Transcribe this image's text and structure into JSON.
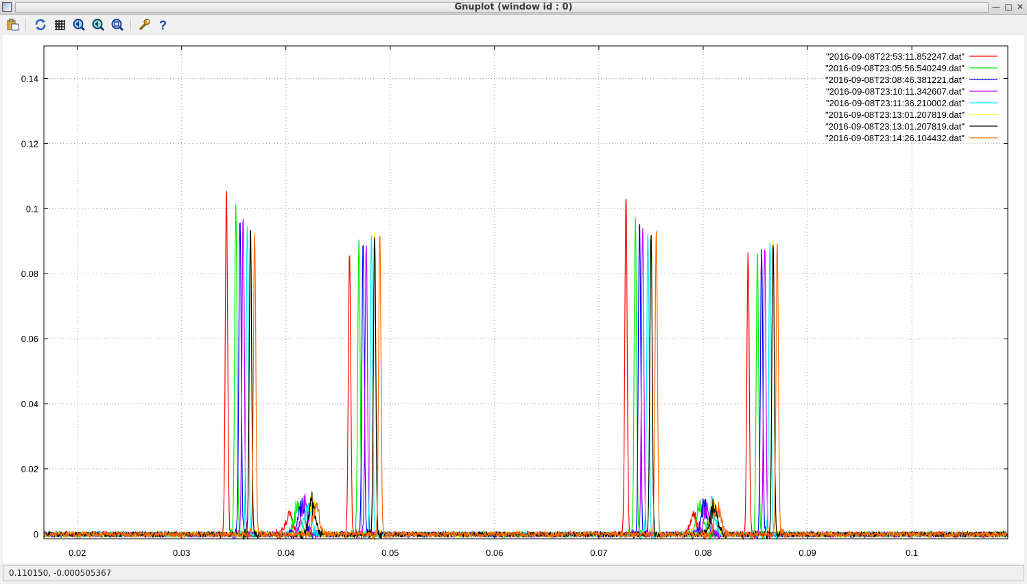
{
  "window": {
    "title": "Gnuplot (window id : 0)",
    "controls": [
      "minimize-icon",
      "maximize-icon",
      "close-icon"
    ]
  },
  "toolbar": {
    "buttons": [
      {
        "name": "copy-export-button",
        "icon": "clipboard-icon"
      },
      {
        "name": "replot-button",
        "icon": "refresh-icon"
      },
      {
        "name": "grid-button",
        "icon": "grid-icon"
      },
      {
        "name": "zoom-previous-button",
        "icon": "zoom-back-icon"
      },
      {
        "name": "zoom-next-button",
        "icon": "zoom-forward-icon"
      },
      {
        "name": "autoscale-button",
        "icon": "zoom-fit-icon"
      },
      {
        "name": "settings-button",
        "icon": "wrench-icon"
      },
      {
        "name": "help-button",
        "icon": "help-icon"
      }
    ]
  },
  "status": {
    "coords": "0.110150, -0.000505367"
  },
  "chart_data": {
    "type": "line",
    "title": "",
    "xlabel": "",
    "ylabel": "",
    "xlim": [
      0.0168,
      0.1092
    ],
    "ylim": [
      -0.0015,
      0.15
    ],
    "x_ticks": [
      "0.02",
      "0.03",
      "0.04",
      "0.05",
      "0.06",
      "0.07",
      "0.08",
      "0.09",
      "0.1"
    ],
    "y_ticks": [
      "0",
      "0.02",
      "0.04",
      "0.06",
      "0.08",
      "0.1",
      "0.12",
      "0.14"
    ],
    "grid": true,
    "legend_position": "top-right",
    "series": [
      {
        "name": "\"2016-09-08T22:53:11.852247.dat\"",
        "color": "#ff0000",
        "peaks": [
          [
            0.0343,
            0.106
          ],
          [
            0.0461,
            0.087
          ],
          [
            0.0726,
            0.104
          ],
          [
            0.0843,
            0.086
          ]
        ],
        "minor": [
          [
            0.0403,
            0.007
          ],
          [
            0.0791,
            0.007
          ]
        ]
      },
      {
        "name": "\"2016-09-08T23:05:56.540249.dat\"",
        "color": "#00ee00",
        "peaks": [
          [
            0.0352,
            0.101
          ],
          [
            0.047,
            0.09
          ],
          [
            0.0735,
            0.098
          ],
          [
            0.0852,
            0.087
          ]
        ],
        "minor": [
          [
            0.0411,
            0.01
          ],
          [
            0.0797,
            0.011
          ]
        ]
      },
      {
        "name": "\"2016-09-08T23:08:46.381221.dat\"",
        "color": "#0000ff",
        "peaks": [
          [
            0.0356,
            0.098
          ],
          [
            0.0474,
            0.091
          ],
          [
            0.0739,
            0.097
          ],
          [
            0.0856,
            0.087
          ]
        ],
        "minor": [
          [
            0.0415,
            0.011
          ],
          [
            0.0801,
            0.01
          ]
        ]
      },
      {
        "name": "\"2016-09-08T23:10:11.342607.dat\"",
        "color": "#c000ff",
        "peaks": [
          [
            0.0359,
            0.098
          ],
          [
            0.0477,
            0.09
          ],
          [
            0.0742,
            0.095
          ],
          [
            0.0859,
            0.089
          ]
        ],
        "minor": [
          [
            0.0418,
            0.011
          ],
          [
            0.0804,
            0.009
          ]
        ]
      },
      {
        "name": "\"2016-09-08T23:11:36.210002.dat\"",
        "color": "#00eeee",
        "peaks": [
          [
            0.0363,
            0.096
          ],
          [
            0.0482,
            0.092
          ],
          [
            0.0747,
            0.093
          ],
          [
            0.0864,
            0.091
          ]
        ],
        "minor": [
          [
            0.0421,
            0.01
          ],
          [
            0.0808,
            0.01
          ]
        ]
      },
      {
        "name": "\"2016-09-08T23:13:01.207819.dat\"",
        "color": "#ffee00",
        "peaks": [
          [
            0.0366,
            0.094
          ],
          [
            0.0485,
            0.093
          ],
          [
            0.075,
            0.092
          ],
          [
            0.0867,
            0.091
          ]
        ],
        "minor": [
          [
            0.0425,
            0.011
          ],
          [
            0.081,
            0.011
          ]
        ]
      },
      {
        "name": "\"2016-09-08T23:13:01.207819.dat\"",
        "color": "#000000",
        "peaks": [
          [
            0.0366,
            0.094
          ],
          [
            0.0485,
            0.093
          ],
          [
            0.075,
            0.092
          ],
          [
            0.0867,
            0.091
          ]
        ],
        "minor": [
          [
            0.0425,
            0.011
          ],
          [
            0.081,
            0.011
          ]
        ]
      },
      {
        "name": "\"2016-09-08T23:14:26.104432.dat\"",
        "color": "#ff6600",
        "peaks": [
          [
            0.037,
            0.093
          ],
          [
            0.049,
            0.092
          ],
          [
            0.0755,
            0.093
          ],
          [
            0.0871,
            0.089
          ]
        ],
        "minor": [
          [
            0.0429,
            0.009
          ],
          [
            0.0814,
            0.009
          ]
        ]
      }
    ]
  }
}
